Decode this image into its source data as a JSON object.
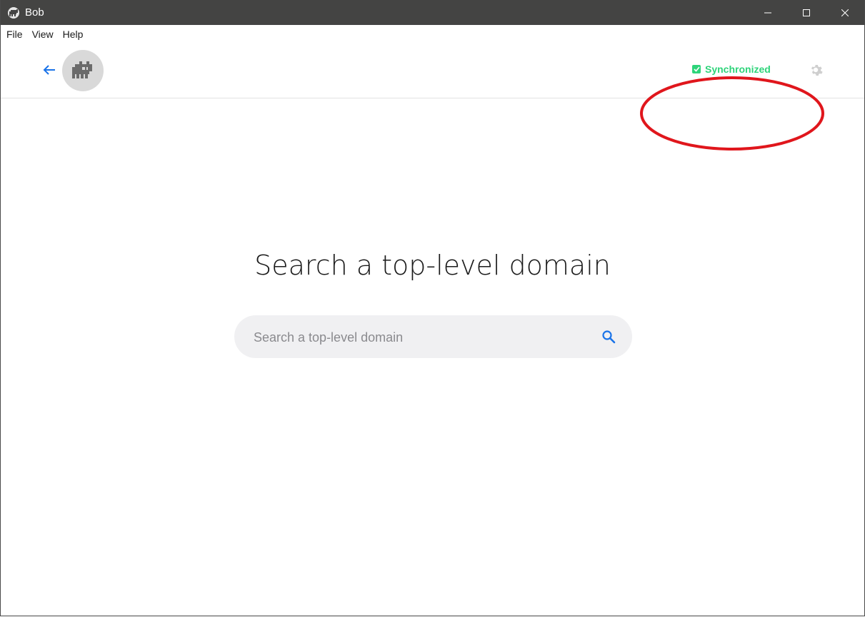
{
  "window": {
    "title": "Bob",
    "controls": [
      "minimize-icon",
      "maximize-icon",
      "close-icon"
    ]
  },
  "menu": {
    "items": [
      {
        "label": "File"
      },
      {
        "label": "View"
      },
      {
        "label": "Help"
      }
    ]
  },
  "header": {
    "back_icon": "arrow-left-icon",
    "avatar_icon": "pixel-cat-icon",
    "sync_status": "Synchronized",
    "sync_icon": "check-box-icon",
    "settings_icon": "gear-icon"
  },
  "main": {
    "heading": "Search a top-level domain",
    "search": {
      "placeholder": "Search a top-level domain",
      "value": "",
      "icon": "search-icon"
    }
  },
  "colors": {
    "titlebar": "#444443",
    "accent_blue": "#1a73e8",
    "sync_green": "#2ed47a",
    "annotation_red": "#e0161c"
  }
}
